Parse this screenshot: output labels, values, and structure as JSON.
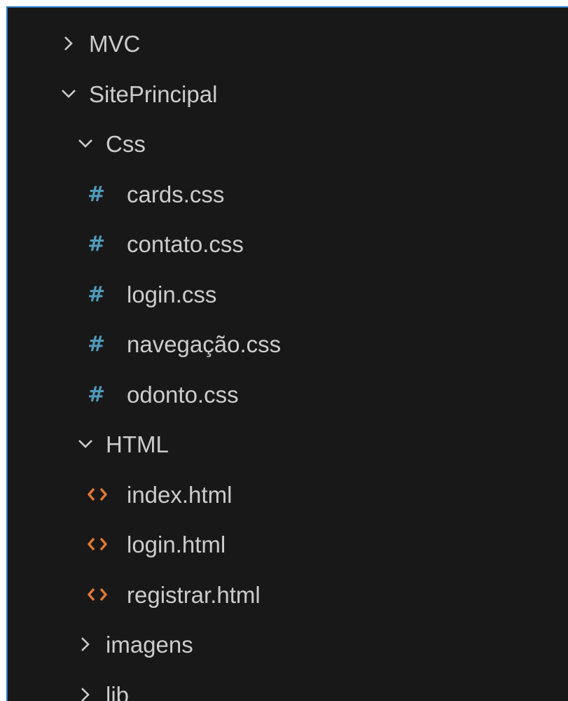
{
  "explorer": {
    "colors": {
      "background": "#181818",
      "focus_border": "#2b79c2",
      "text": "#cccccc",
      "css_icon": "#519aba",
      "html_icon": "#e37933"
    },
    "items": [
      {
        "label": "MVC",
        "type": "folder",
        "state": "collapsed",
        "icon": "chevron-right-icon"
      },
      {
        "label": "SitePrincipal",
        "type": "folder",
        "state": "expanded",
        "icon": "chevron-down-icon"
      },
      {
        "label": "Css",
        "type": "folder",
        "state": "expanded",
        "icon": "chevron-down-icon"
      },
      {
        "label": "cards.css",
        "type": "file",
        "icon": "css-file-icon"
      },
      {
        "label": "contato.css",
        "type": "file",
        "icon": "css-file-icon"
      },
      {
        "label": "login.css",
        "type": "file",
        "icon": "css-file-icon"
      },
      {
        "label": "navegação.css",
        "type": "file",
        "icon": "css-file-icon"
      },
      {
        "label": "odonto.css",
        "type": "file",
        "icon": "css-file-icon"
      },
      {
        "label": "HTML",
        "type": "folder",
        "state": "expanded",
        "icon": "chevron-down-icon"
      },
      {
        "label": "index.html",
        "type": "file",
        "icon": "html-file-icon"
      },
      {
        "label": "login.html",
        "type": "file",
        "icon": "html-file-icon"
      },
      {
        "label": "registrar.html",
        "type": "file",
        "icon": "html-file-icon"
      },
      {
        "label": "imagens",
        "type": "folder",
        "state": "collapsed",
        "icon": "chevron-right-icon"
      },
      {
        "label": "lib",
        "type": "folder",
        "state": "collapsed",
        "icon": "chevron-right-icon"
      }
    ]
  }
}
